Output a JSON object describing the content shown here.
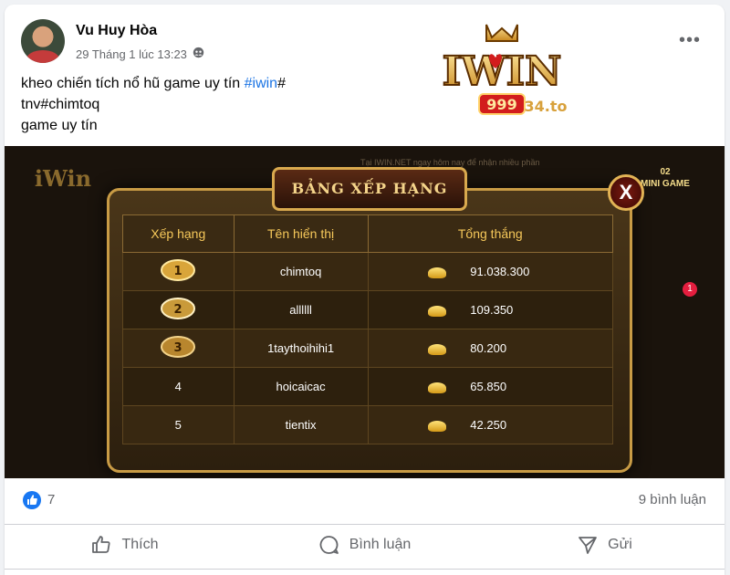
{
  "post": {
    "author": "Vu Huy Hòa",
    "timestamp": "29 Tháng 1 lúc 13:23",
    "privacy_icon": "friends-globe-icon",
    "text_line1": "kheo chiến tích nổ hũ game uy tín ",
    "hashtag": "#iwin",
    "text_line1_end": "#",
    "text_line2": "tnv#chimtoq",
    "text_line3": "game uy tín",
    "more_label": "•••"
  },
  "logo": {
    "brand": "IWIN",
    "sub": "34.to",
    "digits": "999"
  },
  "media": {
    "ticker": "Tại IWIN.NET ngay hôm nay để nhận nhiều phần",
    "title": "BẢNG XẾP HẠNG",
    "close": "X",
    "minigame_label": "MINI GAME",
    "minigame_badge": "02",
    "notif_count": "1",
    "columns": [
      "Xếp hạng",
      "Tên hiển thị",
      "Tổng thắng"
    ],
    "rows": [
      {
        "rank": "1",
        "name": "chimtoq",
        "amount": "91.038.300"
      },
      {
        "rank": "2",
        "name": "allllll",
        "amount": "109.350"
      },
      {
        "rank": "3",
        "name": "1taythoihihi1",
        "amount": "80.200"
      },
      {
        "rank": "4",
        "name": "hoicaicac",
        "amount": "65.850"
      },
      {
        "rank": "5",
        "name": "tientix",
        "amount": "42.250"
      }
    ]
  },
  "stats": {
    "likes": "7",
    "comments": "9 bình luận"
  },
  "actions": {
    "like": "Thích",
    "comment": "Bình luận",
    "share": "Gửi"
  },
  "colors": {
    "accent": "#1877f2",
    "gold": "#f6c85a"
  }
}
